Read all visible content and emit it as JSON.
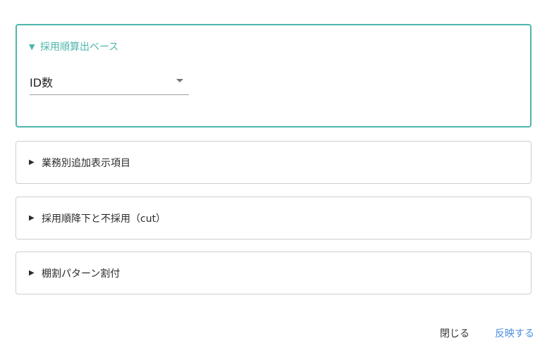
{
  "panels": [
    {
      "title": "採用順算出ベース",
      "expanded": true,
      "arrow": "▼",
      "select": {
        "value": "ID数"
      }
    },
    {
      "title": "業務別追加表示項目",
      "expanded": false,
      "arrow": "▶"
    },
    {
      "title": "採用順降下と不採用（cut）",
      "expanded": false,
      "arrow": "▶"
    },
    {
      "title": "棚割パターン割付",
      "expanded": false,
      "arrow": "▶"
    }
  ],
  "footer": {
    "close_label": "閉じる",
    "apply_label": "反映する"
  },
  "colors": {
    "accent": "#4db6ac",
    "link": "#4a90e2"
  },
  "icons": {
    "expanded": "triangle-down-icon",
    "collapsed": "triangle-right-icon",
    "dropdown": "dropdown-caret-icon"
  }
}
